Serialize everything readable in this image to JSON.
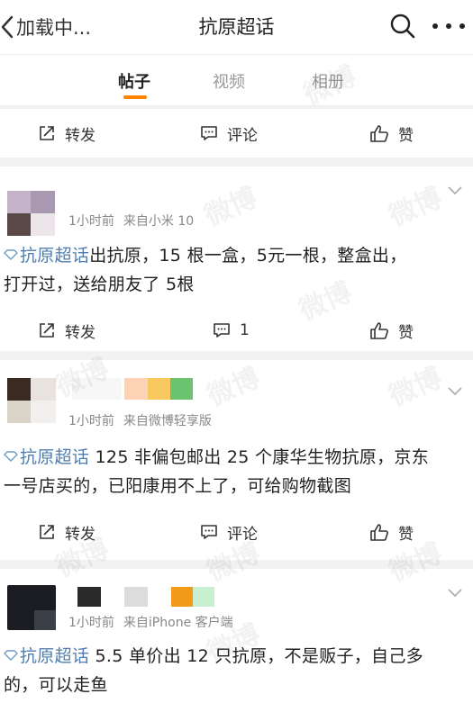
{
  "header": {
    "back_label": "加载中...",
    "title": "抗原超话"
  },
  "tabs": [
    {
      "label": "帖子",
      "active": true
    },
    {
      "label": "视频",
      "active": false
    },
    {
      "label": "相册",
      "active": false
    }
  ],
  "colors": {
    "accent": "#ff8200",
    "topic_link": "#507daf",
    "meta_text": "#888888"
  },
  "top_actions": {
    "repost": "转发",
    "comment": "评论",
    "like": "赞"
  },
  "posts": [
    {
      "time": "1小时前",
      "source": "来自小米 10",
      "topic": "抗原超话",
      "lines": [
        "出抗原，15 根一盒，5元一根，整盒出，",
        "打开过，送给朋友了 5根"
      ],
      "actions": {
        "repost": "转发",
        "comment": "1",
        "like": "赞"
      }
    },
    {
      "time": "1小时前",
      "source": "来自微博轻享版",
      "topic": "抗原超话",
      "lines": [
        " 125 非偏包邮出 25 个康华生物抗原，京东",
        "一号店买的，已阳康用不上了，可给购物截图"
      ],
      "actions": {
        "repost": "转发",
        "comment": "评论",
        "like": "赞"
      }
    },
    {
      "time": "1小时前",
      "source": "来自iPhone 客户端",
      "topic": "抗原超话",
      "lines": [
        " 5.5 单价出 12 只抗原，不是贩子，自己多",
        "的，可以走鱼"
      ]
    }
  ],
  "watermark": "微博"
}
